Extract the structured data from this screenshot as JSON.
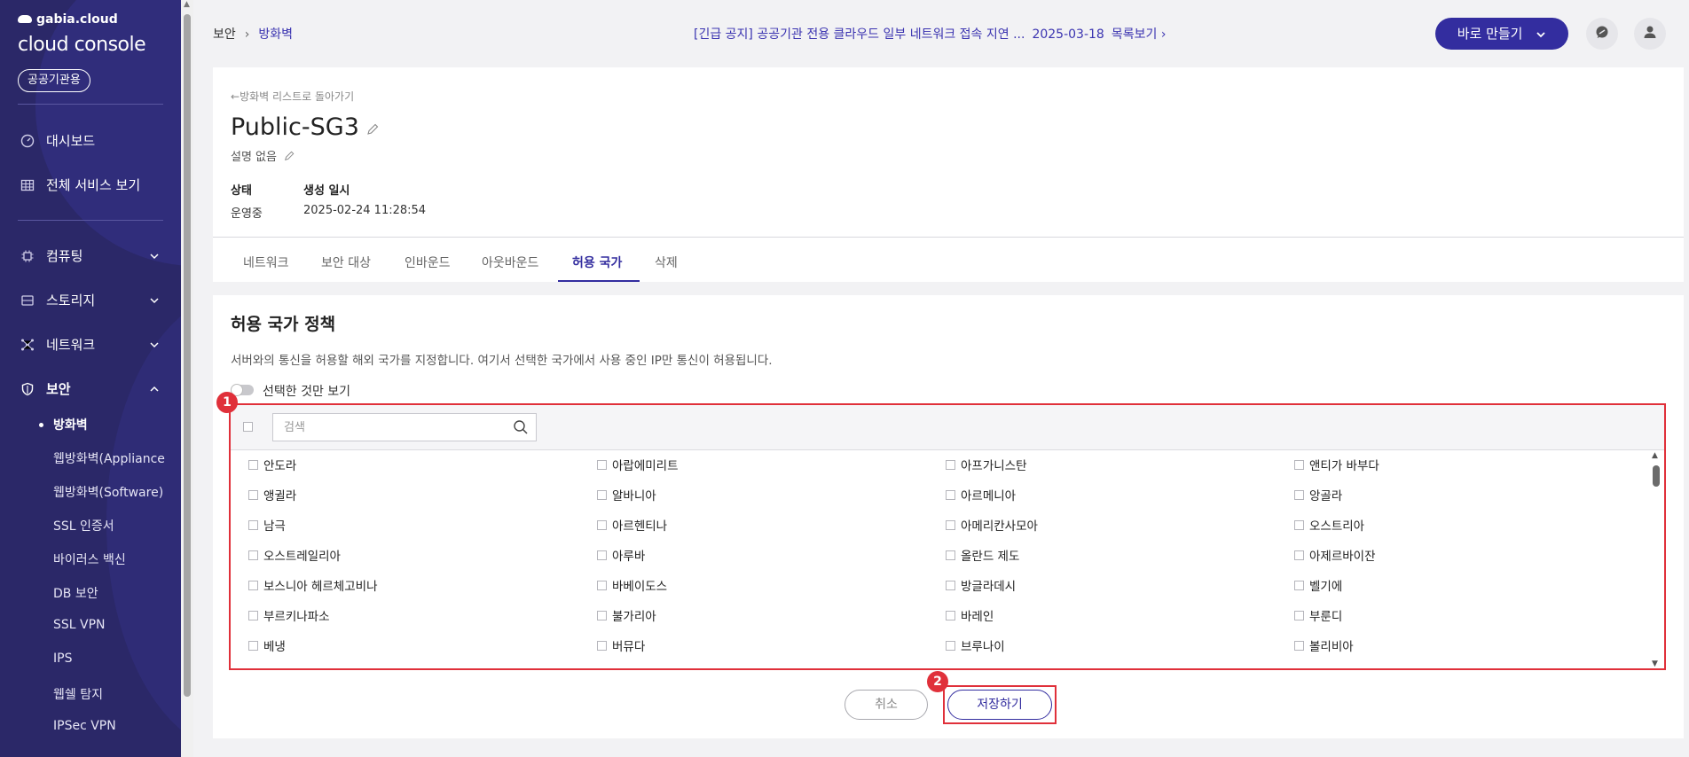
{
  "sidebar": {
    "brand_small": "gabia.cloud",
    "brand_main": "cloud console",
    "gov_badge": "공공기관용",
    "menu": [
      {
        "label": "대시보드",
        "icon": "gauge-icon"
      },
      {
        "label": "전체 서비스 보기",
        "icon": "grid-icon"
      },
      {
        "label": "컴퓨팅",
        "icon": "chip-icon"
      },
      {
        "label": "스토리지",
        "icon": "storage-icon"
      },
      {
        "label": "네트워크",
        "icon": "network-icon"
      },
      {
        "label": "보안",
        "icon": "shield-icon"
      }
    ],
    "security_sub": [
      "방화벽",
      "웹방화벽(Appliance",
      "웹방화벽(Software)",
      "SSL 인증서",
      "바이러스 백신",
      "DB 보안",
      "SSL VPN",
      "IPS",
      "웹쉘 탐지",
      "IPSec VPN"
    ]
  },
  "header": {
    "breadcrumb": [
      "보안",
      "방화벽"
    ],
    "notice": "[긴급 공지] 공공기관 전용 클라우드 일부 네트워크 접속 지연 ...",
    "notice_date": "2025-03-18",
    "notice_more": "목록보기",
    "make_button": "바로 만들기"
  },
  "detail": {
    "back_link": "방화벽 리스트로 돌아가기",
    "title": "Public-SG3",
    "description": "설명 없음",
    "status_label": "상태",
    "status_value": "운영중",
    "created_label": "생성 일시",
    "created_value": "2025-02-24 11:28:54",
    "tabs": [
      "네트워크",
      "보안 대상",
      "인바운드",
      "아웃바운드",
      "허용 국가",
      "삭제"
    ],
    "active_tab": "허용 국가"
  },
  "policy": {
    "title": "허용 국가 정책",
    "description": "서버와의 통신을 허용할 해외 국가를 지정합니다. 여기서 선택한 국가에서 사용 중인 IP만 통신이 허용됩니다.",
    "toggle_label": "선택한 것만 보기",
    "search_placeholder": "검색",
    "countries": [
      [
        "안도라",
        "아랍에미리트",
        "아프가니스탄",
        "앤티가 바부다"
      ],
      [
        "앵귈라",
        "알바니아",
        "아르메니아",
        "앙골라"
      ],
      [
        "남극",
        "아르헨티나",
        "아메리칸사모아",
        "오스트리아"
      ],
      [
        "오스트레일리아",
        "아루바",
        "올란드 제도",
        "아제르바이잔"
      ],
      [
        "보스니아 헤르체고비나",
        "바베이도스",
        "방글라데시",
        "벨기에"
      ],
      [
        "부르키나파소",
        "불가리아",
        "바레인",
        "부룬디"
      ],
      [
        "베냉",
        "버뮤다",
        "브루나이",
        "볼리비아"
      ]
    ],
    "cancel_label": "취소",
    "save_label": "저장하기",
    "annotation_1": "1",
    "annotation_2": "2"
  },
  "colors": {
    "sidebar_bg": "#2b2868",
    "accent": "#332d9f",
    "highlight": "#e0303a"
  }
}
